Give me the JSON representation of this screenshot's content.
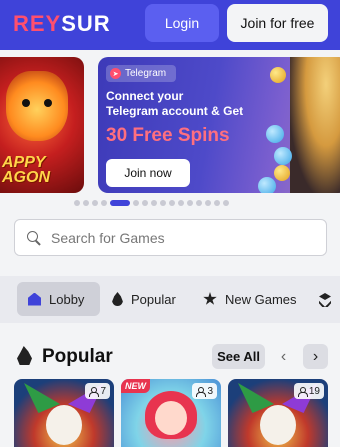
{
  "header": {
    "logo_part1": "REY",
    "logo_part2": "SUR",
    "login_label": "Login",
    "join_label": "Join for free"
  },
  "banner": {
    "left_slide_text": "APPY\nAGON",
    "badge": "Telegram",
    "line1": "Connect your",
    "line2": "Telegram account & Get",
    "highlight": "30 Free Spins",
    "cta": "Join now",
    "dots_count": 16,
    "active_dot": 4
  },
  "search": {
    "placeholder": "Search for Games"
  },
  "tabs": [
    {
      "label": "Lobby",
      "icon": "home-icon",
      "active": true
    },
    {
      "label": "Popular",
      "icon": "fire-icon",
      "active": false
    },
    {
      "label": "New Games",
      "icon": "star-icon",
      "active": false
    },
    {
      "label": "",
      "icon": "layers-icon",
      "active": false
    }
  ],
  "section": {
    "title": "Popular",
    "see_all": "See All",
    "prev": "‹",
    "next": "›"
  },
  "games": [
    {
      "players": "7",
      "new": false
    },
    {
      "players": "3",
      "new": true,
      "badge": "NEW"
    },
    {
      "players": "19",
      "new": false
    }
  ],
  "colors": {
    "header_bg": "#3f43d9",
    "accent": "#ff4f6e",
    "login_bg": "#5b5ff0"
  }
}
